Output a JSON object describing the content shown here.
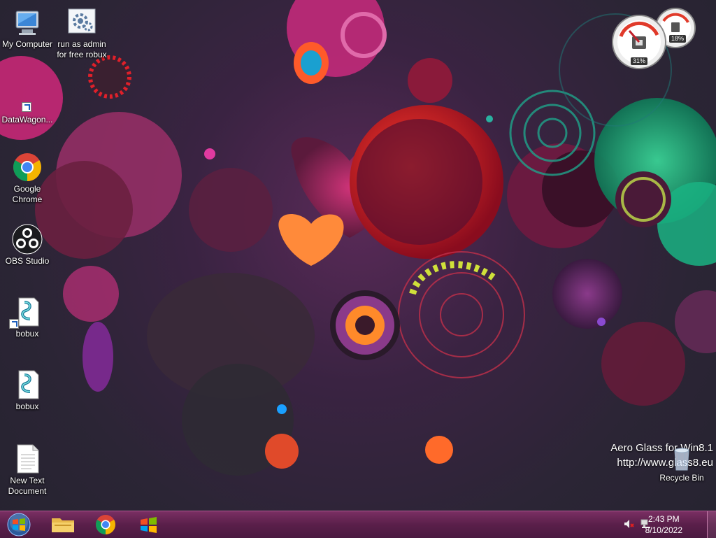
{
  "desktop": {
    "icons": [
      {
        "label": "My Computer"
      },
      {
        "label": "run as admin for free robux"
      },
      {
        "label": "DataWagon..."
      },
      {
        "label": "Google Chrome"
      },
      {
        "label": "OBS Studio"
      },
      {
        "label": "bobux"
      },
      {
        "label": "bobux"
      },
      {
        "label": "New Text Document"
      },
      {
        "label": "Recycle Bin"
      }
    ],
    "watermark": {
      "line1": "Aero Glass for Win8.1",
      "line2": "http://www.glass8.eu"
    }
  },
  "gadget": {
    "cpu_percent": "31%",
    "memory_percent": "18%"
  },
  "taskbar": {
    "pinned": [
      "file-explorer-icon",
      "chrome-icon",
      "windows-media-icon"
    ],
    "clock": {
      "time": "2:43 PM",
      "date": "8/10/2022"
    }
  },
  "colors": {
    "taskbar": "#5a1f4a",
    "accent": "#b05a92"
  }
}
